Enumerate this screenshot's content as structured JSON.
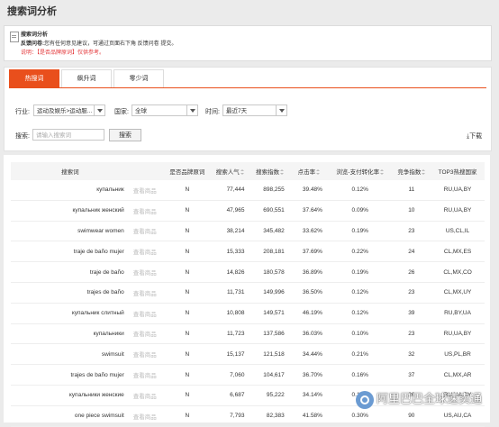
{
  "page": {
    "title": "搜索词分析"
  },
  "notice": {
    "title": "搜索词分析",
    "feedback_label": "反馈问卷:",
    "feedback_text": "您有任何意见建议，可通过页面右下角 反馈问卷 提交。",
    "note": "说明：【是否品牌原词】仅供参考。"
  },
  "tabs": [
    {
      "label": "热搜词",
      "active": true
    },
    {
      "label": "飙升词",
      "active": false
    },
    {
      "label": "零少词",
      "active": false
    }
  ],
  "filters": {
    "industry_label": "行业:",
    "industry_value": "运动及娱乐>运动服...",
    "country_label": "国家:",
    "country_value": "全球",
    "time_label": "时间:",
    "time_value": "最近7天",
    "search_label": "搜索:",
    "search_placeholder": "请输入搜索词",
    "search_button": "搜索",
    "download_label": "下载"
  },
  "table": {
    "headers": [
      "搜索词",
      "",
      "是否品牌原词",
      "搜索人气",
      "搜索指数",
      "点击率",
      "浏览-支付转化率",
      "竞争指数",
      "TOP3热搜国家"
    ],
    "link_text": "查看商品",
    "rows": [
      [
        "купальник",
        "N",
        "77,444",
        "898,255",
        "39.48%",
        "0.12%",
        "11",
        "RU,UA,BY"
      ],
      [
        "купальник женский",
        "N",
        "47,965",
        "690,551",
        "37.64%",
        "0.09%",
        "10",
        "RU,UA,BY"
      ],
      [
        "swimwear women",
        "N",
        "38,214",
        "345,482",
        "33.62%",
        "0.19%",
        "23",
        "US,CL,IL"
      ],
      [
        "traje de baño mujer",
        "N",
        "15,333",
        "208,181",
        "37.69%",
        "0.22%",
        "24",
        "CL,MX,ES"
      ],
      [
        "traje de baño",
        "N",
        "14,826",
        "180,578",
        "36.89%",
        "0.19%",
        "26",
        "CL,MX,CO"
      ],
      [
        "trajes de baño",
        "N",
        "11,731",
        "149,996",
        "36.50%",
        "0.12%",
        "23",
        "CL,MX,UY"
      ],
      [
        "купальник слитный",
        "N",
        "10,808",
        "149,571",
        "46.19%",
        "0.12%",
        "39",
        "RU,BY,UA"
      ],
      [
        "купальники",
        "N",
        "11,723",
        "137,586",
        "36.03%",
        "0.10%",
        "23",
        "RU,UA,BY"
      ],
      [
        "swimsuit",
        "N",
        "15,137",
        "121,518",
        "34.44%",
        "0.21%",
        "32",
        "US,PL,BR"
      ],
      [
        "trajes de baño mujer",
        "N",
        "7,060",
        "104,617",
        "36.70%",
        "0.16%",
        "37",
        "CL,MX,AR"
      ],
      [
        "купальники женские",
        "N",
        "6,687",
        "95,222",
        "34.14%",
        "0.10%",
        "26",
        "RU,UA,BY"
      ],
      [
        "one piece swimsuit",
        "N",
        "7,793",
        "82,383",
        "41.58%",
        "0.30%",
        "90",
        "US,AU,CA"
      ]
    ]
  },
  "watermark": {
    "text": "阿里巴巴全球速卖通"
  },
  "colors": {
    "accent": "#e94f1c",
    "note_red": "#e4393c"
  }
}
